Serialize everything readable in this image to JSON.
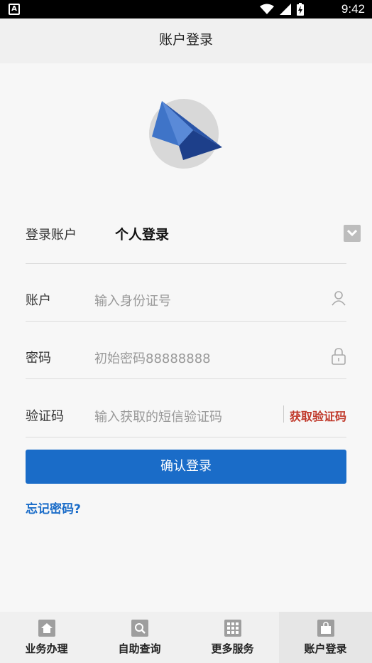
{
  "status_bar": {
    "time": "9:42",
    "notification_glyph": "A"
  },
  "header": {
    "title": "账户登录"
  },
  "form": {
    "account_type_label": "登录账户",
    "account_type_value": "个人登录",
    "account_label": "账户",
    "account_placeholder": "输入身份证号",
    "password_label": "密码",
    "password_placeholder": "初始密码88888888",
    "code_label": "验证码",
    "code_placeholder": "输入获取的短信验证码",
    "get_code_label": "获取验证码",
    "submit_label": "确认登录",
    "forgot_label": "忘记密码?"
  },
  "tabs": [
    {
      "label": "业务办理",
      "icon": "home-icon",
      "active": false
    },
    {
      "label": "自助查询",
      "icon": "search-icon",
      "active": false
    },
    {
      "label": "更多服务",
      "icon": "grid-icon",
      "active": false
    },
    {
      "label": "账户登录",
      "icon": "bag-icon",
      "active": true
    }
  ],
  "colors": {
    "primary": "#1a6cc8",
    "accent_red": "#c0392b"
  }
}
